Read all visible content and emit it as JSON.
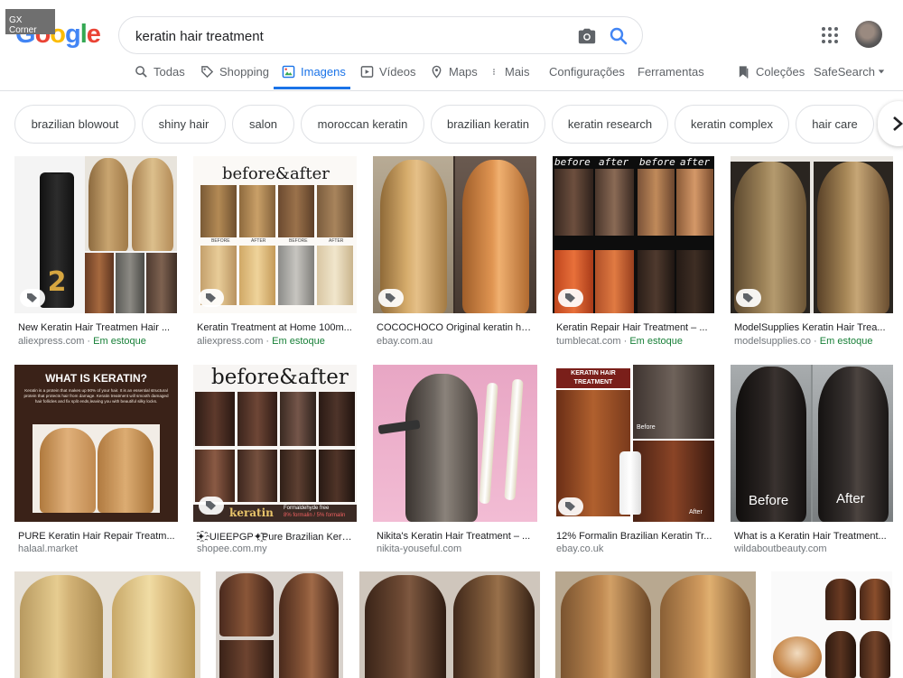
{
  "badge": "GX Corner",
  "logo": [
    "G",
    "o",
    "o",
    "g",
    "l",
    "e"
  ],
  "search": {
    "query": "keratin hair treatment"
  },
  "tabs": [
    {
      "label": "Todas",
      "icon": "search-icon"
    },
    {
      "label": "Shopping",
      "icon": "tag-icon"
    },
    {
      "label": "Imagens",
      "icon": "image-icon",
      "active": true
    },
    {
      "label": "Vídeos",
      "icon": "video-icon"
    },
    {
      "label": "Maps",
      "icon": "map-pin-icon"
    },
    {
      "label": "Mais",
      "icon": "more-vert-icon"
    },
    {
      "label": "Configurações"
    },
    {
      "label": "Ferramentas"
    },
    {
      "label": "Coleções",
      "icon": "bookmark-icon"
    },
    {
      "label": "SafeSearch",
      "icon": "caret-down-icon"
    }
  ],
  "chips": [
    "brazilian blowout",
    "shiny hair",
    "salon",
    "moroccan keratin",
    "brazilian keratin",
    "keratin research",
    "keratin complex",
    "hair care"
  ],
  "stock_label": "Em estoque",
  "results": [
    {
      "title": "New Keratin Hair Treatmen Hair ...",
      "source": "aliexpress.com",
      "stock": true,
      "product_text": "2"
    },
    {
      "title": "Keratin Treatment at Home 100m...",
      "source": "aliexpress.com",
      "stock": true,
      "banner": "before&after",
      "cell_labels": [
        "BEFORE",
        "AFTER",
        "BEFORE",
        "AFTER",
        "BEFORE",
        "AFTER"
      ]
    },
    {
      "title": "COCOCHOCO Original keratin hai...",
      "source": "ebay.com.au",
      "stock": false
    },
    {
      "title": "Keratin Repair Hair Treatment – ...",
      "source": "tumblecat.com",
      "stock": true,
      "overlay": [
        "before",
        "after",
        "before",
        "after"
      ]
    },
    {
      "title": "ModelSupplies Keratin Hair Trea...",
      "source": "modelsupplies.co",
      "stock": true
    },
    {
      "title": "PURE Keratin Hair Repair Treatm...",
      "source": "halaal.market",
      "stock": false,
      "heading": "WHAT IS KERATIN?",
      "body": "Keratin is a protein that makes up 90% of your hair. It is an essential structural protein that protects hair from damage. Keratin treatment will smooth damaged hair follicles and fix split ends,leaving you with beautiful silky locks."
    },
    {
      "title": "✦҈UIEEPGP✦҈Pure Brazilian Kerat...",
      "source": "shopee.com.my",
      "stock": false,
      "banner": "before&after",
      "footer": [
        "keratin",
        "Formaldehyde free",
        "8% formalin / 5% formalin"
      ]
    },
    {
      "title": "Nikita's Keratin Hair Treatment – ...",
      "source": "nikita-youseful.com",
      "stock": false
    },
    {
      "title": "12% Formalin Brazilian Keratin Tr...",
      "source": "ebay.co.uk",
      "stock": false,
      "box_text": "KERATIN HAIR TREATMENT",
      "labels": [
        "Before",
        "After"
      ]
    },
    {
      "title": "What is a Keratin Hair Treatment...",
      "source": "wildaboutbeauty.com",
      "stock": false,
      "labels": [
        "Before",
        "After"
      ]
    }
  ],
  "colors": {
    "accent": "#1a73e8",
    "stock": "#188038",
    "muted": "#70757a"
  }
}
